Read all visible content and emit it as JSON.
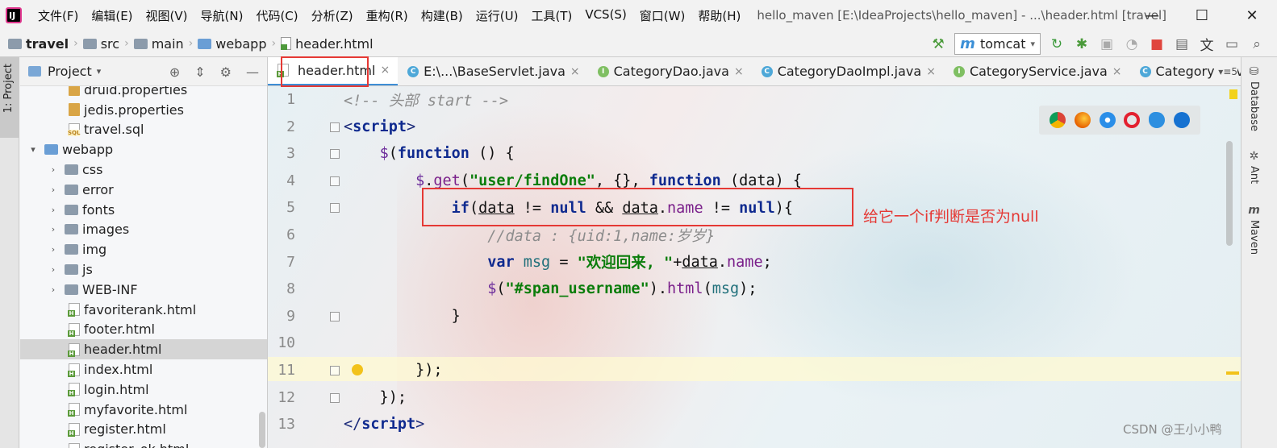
{
  "menubar": {
    "logo_text": "IJ",
    "items": [
      "文件(F)",
      "编辑(E)",
      "视图(V)",
      "导航(N)",
      "代码(C)",
      "分析(Z)",
      "重构(R)",
      "构建(B)",
      "运行(U)",
      "工具(T)",
      "VCS(S)",
      "窗口(W)",
      "帮助(H)"
    ],
    "window_title": "hello_maven [E:\\IdeaProjects\\hello_maven] - ...\\header.html [travel]",
    "controls": [
      "—",
      "☐",
      "✕"
    ]
  },
  "navbar": {
    "breadcrumbs": [
      "travel",
      "src",
      "main",
      "webapp",
      "header.html"
    ],
    "run_config": "tomcat"
  },
  "left_stripe": {
    "label": "1: Project"
  },
  "project_panel": {
    "title": "Project",
    "tree": [
      {
        "label": "druid.properties",
        "icon": "properties-file-icon",
        "arrow": ""
      },
      {
        "label": "jedis.properties",
        "icon": "properties-file-icon",
        "arrow": ""
      },
      {
        "label": "travel.sql",
        "icon": "sql-file-icon",
        "arrow": ""
      },
      {
        "label": "webapp",
        "icon": "web-folder-icon",
        "arrow": "▾"
      },
      {
        "label": "css",
        "icon": "folder-icon",
        "arrow": "›"
      },
      {
        "label": "error",
        "icon": "folder-icon",
        "arrow": "›"
      },
      {
        "label": "fonts",
        "icon": "folder-icon",
        "arrow": "›"
      },
      {
        "label": "images",
        "icon": "folder-icon",
        "arrow": "›"
      },
      {
        "label": "img",
        "icon": "folder-icon",
        "arrow": "›"
      },
      {
        "label": "js",
        "icon": "folder-icon",
        "arrow": "›"
      },
      {
        "label": "WEB-INF",
        "icon": "folder-icon",
        "arrow": "›"
      },
      {
        "label": "favoriterank.html",
        "icon": "html-file-icon",
        "arrow": ""
      },
      {
        "label": "footer.html",
        "icon": "html-file-icon",
        "arrow": ""
      },
      {
        "label": "header.html",
        "icon": "html-file-icon",
        "arrow": "",
        "selected": true
      },
      {
        "label": "index.html",
        "icon": "html-file-icon",
        "arrow": ""
      },
      {
        "label": "login.html",
        "icon": "html-file-icon",
        "arrow": ""
      },
      {
        "label": "myfavorite.html",
        "icon": "html-file-icon",
        "arrow": ""
      },
      {
        "label": "register.html",
        "icon": "html-file-icon",
        "arrow": ""
      },
      {
        "label": "register_ok.html",
        "icon": "html-file-icon",
        "arrow": ""
      }
    ]
  },
  "tabs": [
    {
      "label": "header.html",
      "icon": "html",
      "active": true
    },
    {
      "label": "E:\\...\\BaseServlet.java",
      "icon": "class"
    },
    {
      "label": "CategoryDao.java",
      "icon": "interface"
    },
    {
      "label": "CategoryDaoImpl.java",
      "icon": "class"
    },
    {
      "label": "CategoryService.java",
      "icon": "interface"
    },
    {
      "label": "CategoryServiceImp",
      "icon": "class"
    }
  ],
  "tab_overflow": "▾≡5",
  "editor": {
    "line_numbers": [
      "1",
      "2",
      "3",
      "4",
      "5",
      "6",
      "7",
      "8",
      "9",
      "10",
      "11",
      "12",
      "13"
    ],
    "lines": [
      [
        {
          "t": "<!-- 头部 start -->",
          "c": "c-comment"
        }
      ],
      [
        {
          "t": "<",
          "c": "c-tag"
        },
        {
          "t": "script",
          "c": "c-kw"
        },
        {
          "t": ">",
          "c": "c-tag"
        }
      ],
      [
        {
          "t": "    ",
          "c": "c-plain"
        },
        {
          "t": "$",
          "c": "c-fn"
        },
        {
          "t": "(",
          "c": "c-plain"
        },
        {
          "t": "function",
          "c": "c-kw"
        },
        {
          "t": " () {",
          "c": "c-plain"
        }
      ],
      [
        {
          "t": "        ",
          "c": "c-plain"
        },
        {
          "t": "$",
          "c": "c-fn"
        },
        {
          "t": ".",
          "c": "c-plain"
        },
        {
          "t": "get",
          "c": "c-prop"
        },
        {
          "t": "(",
          "c": "c-plain"
        },
        {
          "t": "\"user/findOne\"",
          "c": "c-str"
        },
        {
          "t": ", {}, ",
          "c": "c-plain"
        },
        {
          "t": "function",
          "c": "c-kw"
        },
        {
          "t": " (data) {",
          "c": "c-plain"
        }
      ],
      [
        {
          "t": "            ",
          "c": "c-plain"
        },
        {
          "t": "if",
          "c": "c-kw"
        },
        {
          "t": "(",
          "c": "c-plain"
        },
        {
          "t": "data",
          "c": "c-var"
        },
        {
          "t": " != ",
          "c": "c-plain"
        },
        {
          "t": "null",
          "c": "c-kw"
        },
        {
          "t": " && ",
          "c": "c-plain"
        },
        {
          "t": "data",
          "c": "c-var"
        },
        {
          "t": ".",
          "c": "c-plain"
        },
        {
          "t": "name",
          "c": "c-prop"
        },
        {
          "t": " != ",
          "c": "c-plain"
        },
        {
          "t": "null",
          "c": "c-kw"
        },
        {
          "t": "){",
          "c": "c-plain"
        }
      ],
      [
        {
          "t": "                ",
          "c": "c-plain"
        },
        {
          "t": "//data : {uid:1,name:岁岁}",
          "c": "c-comment"
        }
      ],
      [
        {
          "t": "                ",
          "c": "c-plain"
        },
        {
          "t": "var",
          "c": "c-kw"
        },
        {
          "t": " ",
          "c": "c-plain"
        },
        {
          "t": "msg",
          "c": "c-id"
        },
        {
          "t": " = ",
          "c": "c-plain"
        },
        {
          "t": "\"欢迎回来, \"",
          "c": "c-str"
        },
        {
          "t": "+",
          "c": "c-plain"
        },
        {
          "t": "data",
          "c": "c-var"
        },
        {
          "t": ".",
          "c": "c-plain"
        },
        {
          "t": "name",
          "c": "c-prop"
        },
        {
          "t": ";",
          "c": "c-plain"
        }
      ],
      [
        {
          "t": "                ",
          "c": "c-plain"
        },
        {
          "t": "$",
          "c": "c-fn"
        },
        {
          "t": "(",
          "c": "c-plain"
        },
        {
          "t": "\"#span_username\"",
          "c": "c-str"
        },
        {
          "t": ").",
          "c": "c-plain"
        },
        {
          "t": "html",
          "c": "c-prop"
        },
        {
          "t": "(",
          "c": "c-plain"
        },
        {
          "t": "msg",
          "c": "c-id"
        },
        {
          "t": ");",
          "c": "c-plain"
        }
      ],
      [
        {
          "t": "            }",
          "c": "c-plain"
        }
      ],
      [],
      [
        {
          "t": "        });",
          "c": "c-plain"
        }
      ],
      [
        {
          "t": "    });",
          "c": "c-plain"
        }
      ],
      [
        {
          "t": "</",
          "c": "c-tag"
        },
        {
          "t": "script",
          "c": "c-kw"
        },
        {
          "t": ">",
          "c": "c-tag"
        }
      ]
    ],
    "annotation": "给它一个if判断是否为null"
  },
  "right_stripe": [
    "Database",
    "Ant",
    "Maven"
  ],
  "watermark": "CSDN @王小小鸭"
}
